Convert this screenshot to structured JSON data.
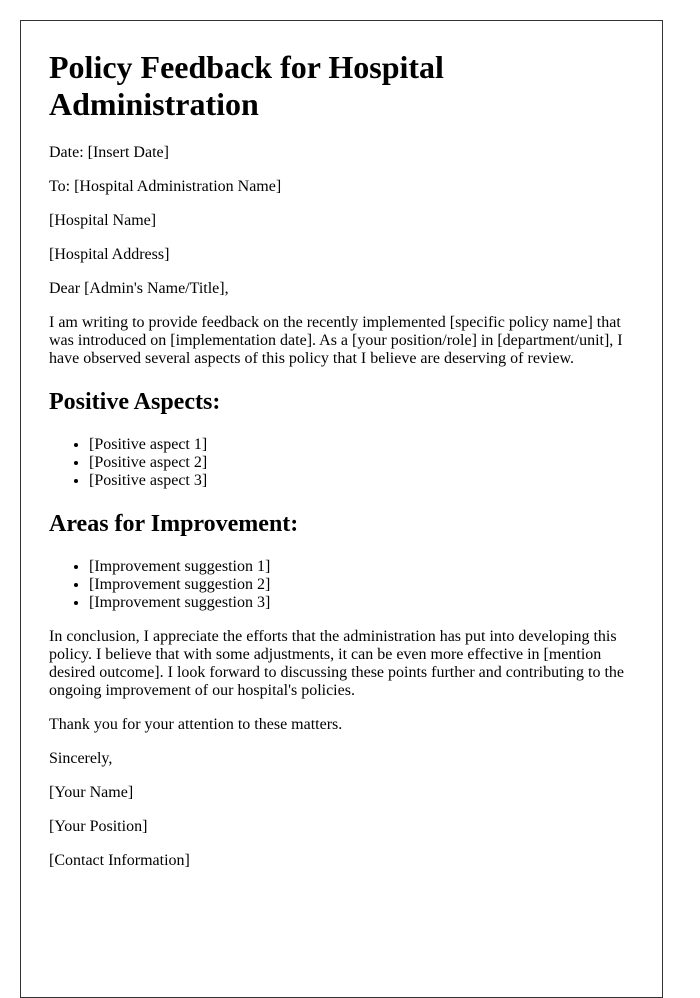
{
  "document": {
    "title": "Policy Feedback for Hospital Administration",
    "date_line": "Date: [Insert Date]",
    "to_line": "To: [Hospital Administration Name]",
    "hospital_name": "[Hospital Name]",
    "hospital_address": "[Hospital Address]",
    "salutation": "Dear [Admin's Name/Title],",
    "intro_paragraph": "I am writing to provide feedback on the recently implemented [specific policy name] that was introduced on [implementation date]. As a [your position/role] in [department/unit], I have observed several aspects of this policy that I believe are deserving of review.",
    "sections": [
      {
        "heading": "Positive Aspects:",
        "items": [
          "[Positive aspect 1]",
          "[Positive aspect 2]",
          "[Positive aspect 3]"
        ]
      },
      {
        "heading": "Areas for Improvement:",
        "items": [
          "[Improvement suggestion 1]",
          "[Improvement suggestion 2]",
          "[Improvement suggestion 3]"
        ]
      }
    ],
    "conclusion_paragraph": "In conclusion, I appreciate the efforts that the administration has put into developing this policy. I believe that with some adjustments, it can be even more effective in [mention desired outcome]. I look forward to discussing these points further and contributing to the ongoing improvement of our hospital's policies.",
    "thanks_line": "Thank you for your attention to these matters.",
    "closing": "Sincerely,",
    "signature": {
      "name": "[Your Name]",
      "position": "[Your Position]",
      "contact": "[Contact Information]"
    }
  },
  "colors": {
    "text": "#000000",
    "border": "#333333",
    "background": "#ffffff"
  }
}
